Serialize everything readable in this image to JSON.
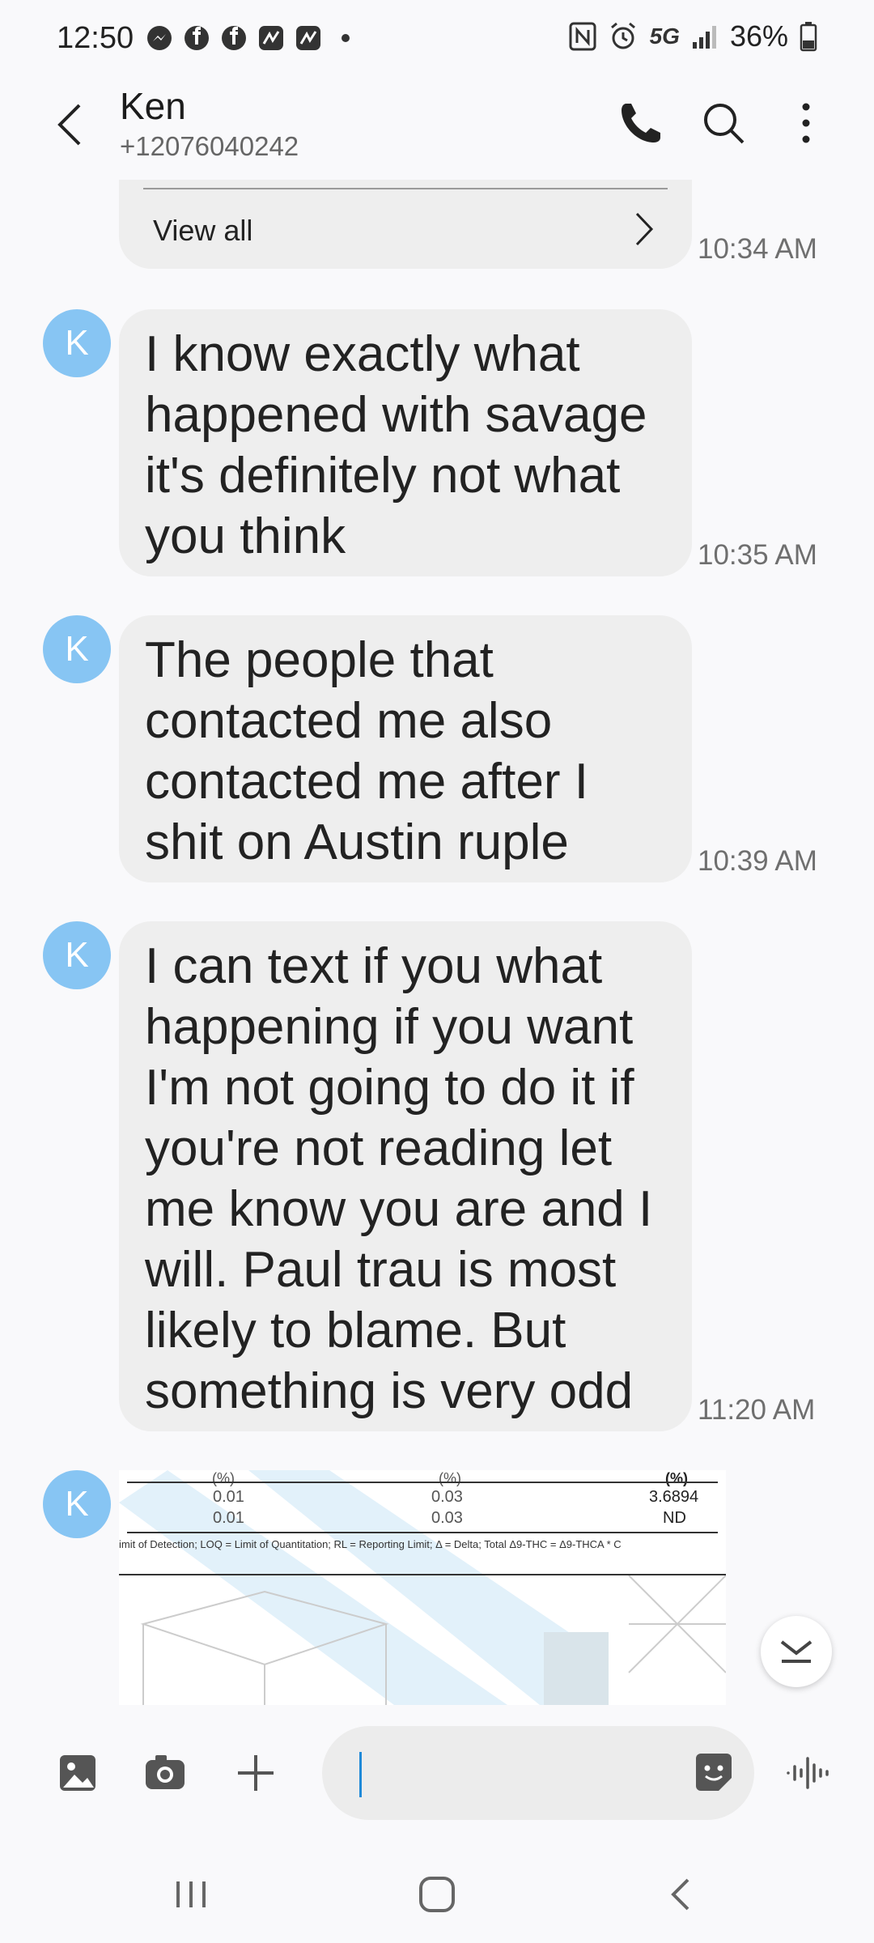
{
  "status": {
    "time": "12:50",
    "battery": "36%",
    "network": "5G"
  },
  "header": {
    "contact_name": "Ken",
    "contact_number": "+12076040242"
  },
  "top_card": {
    "view_all_label": "View all",
    "time": "10:34 AM"
  },
  "avatar_letter": "K",
  "messages": [
    {
      "text": "I know exactly what happened with savage it's definitely not what you think",
      "time": "10:35 AM"
    },
    {
      "text": "The people that contacted me also contacted me after I shit on Austin ruple",
      "time": "10:39 AM"
    },
    {
      "text": "I can text if you what happening if you want I'm not going to do it if you're not reading let me know you are and I will.  Paul trau is most likely to blame. But something is very odd",
      "time": "11:20 AM"
    }
  ],
  "attachment": {
    "header_units": [
      "(%)",
      "(%)",
      "(%)"
    ],
    "rows": [
      [
        "0.01",
        "0.03",
        "3.6894"
      ],
      [
        "0.01",
        "0.03",
        "ND"
      ]
    ],
    "footnote": "imit of Detection; LOQ = Limit of Quantitation; RL = Reporting Limit; Δ = Delta; Total Δ9-THC = Δ9-THCA * C"
  },
  "colors": {
    "bubble": "#eeeeee",
    "avatar": "#87c5f3",
    "caret": "#1f8ad8"
  }
}
